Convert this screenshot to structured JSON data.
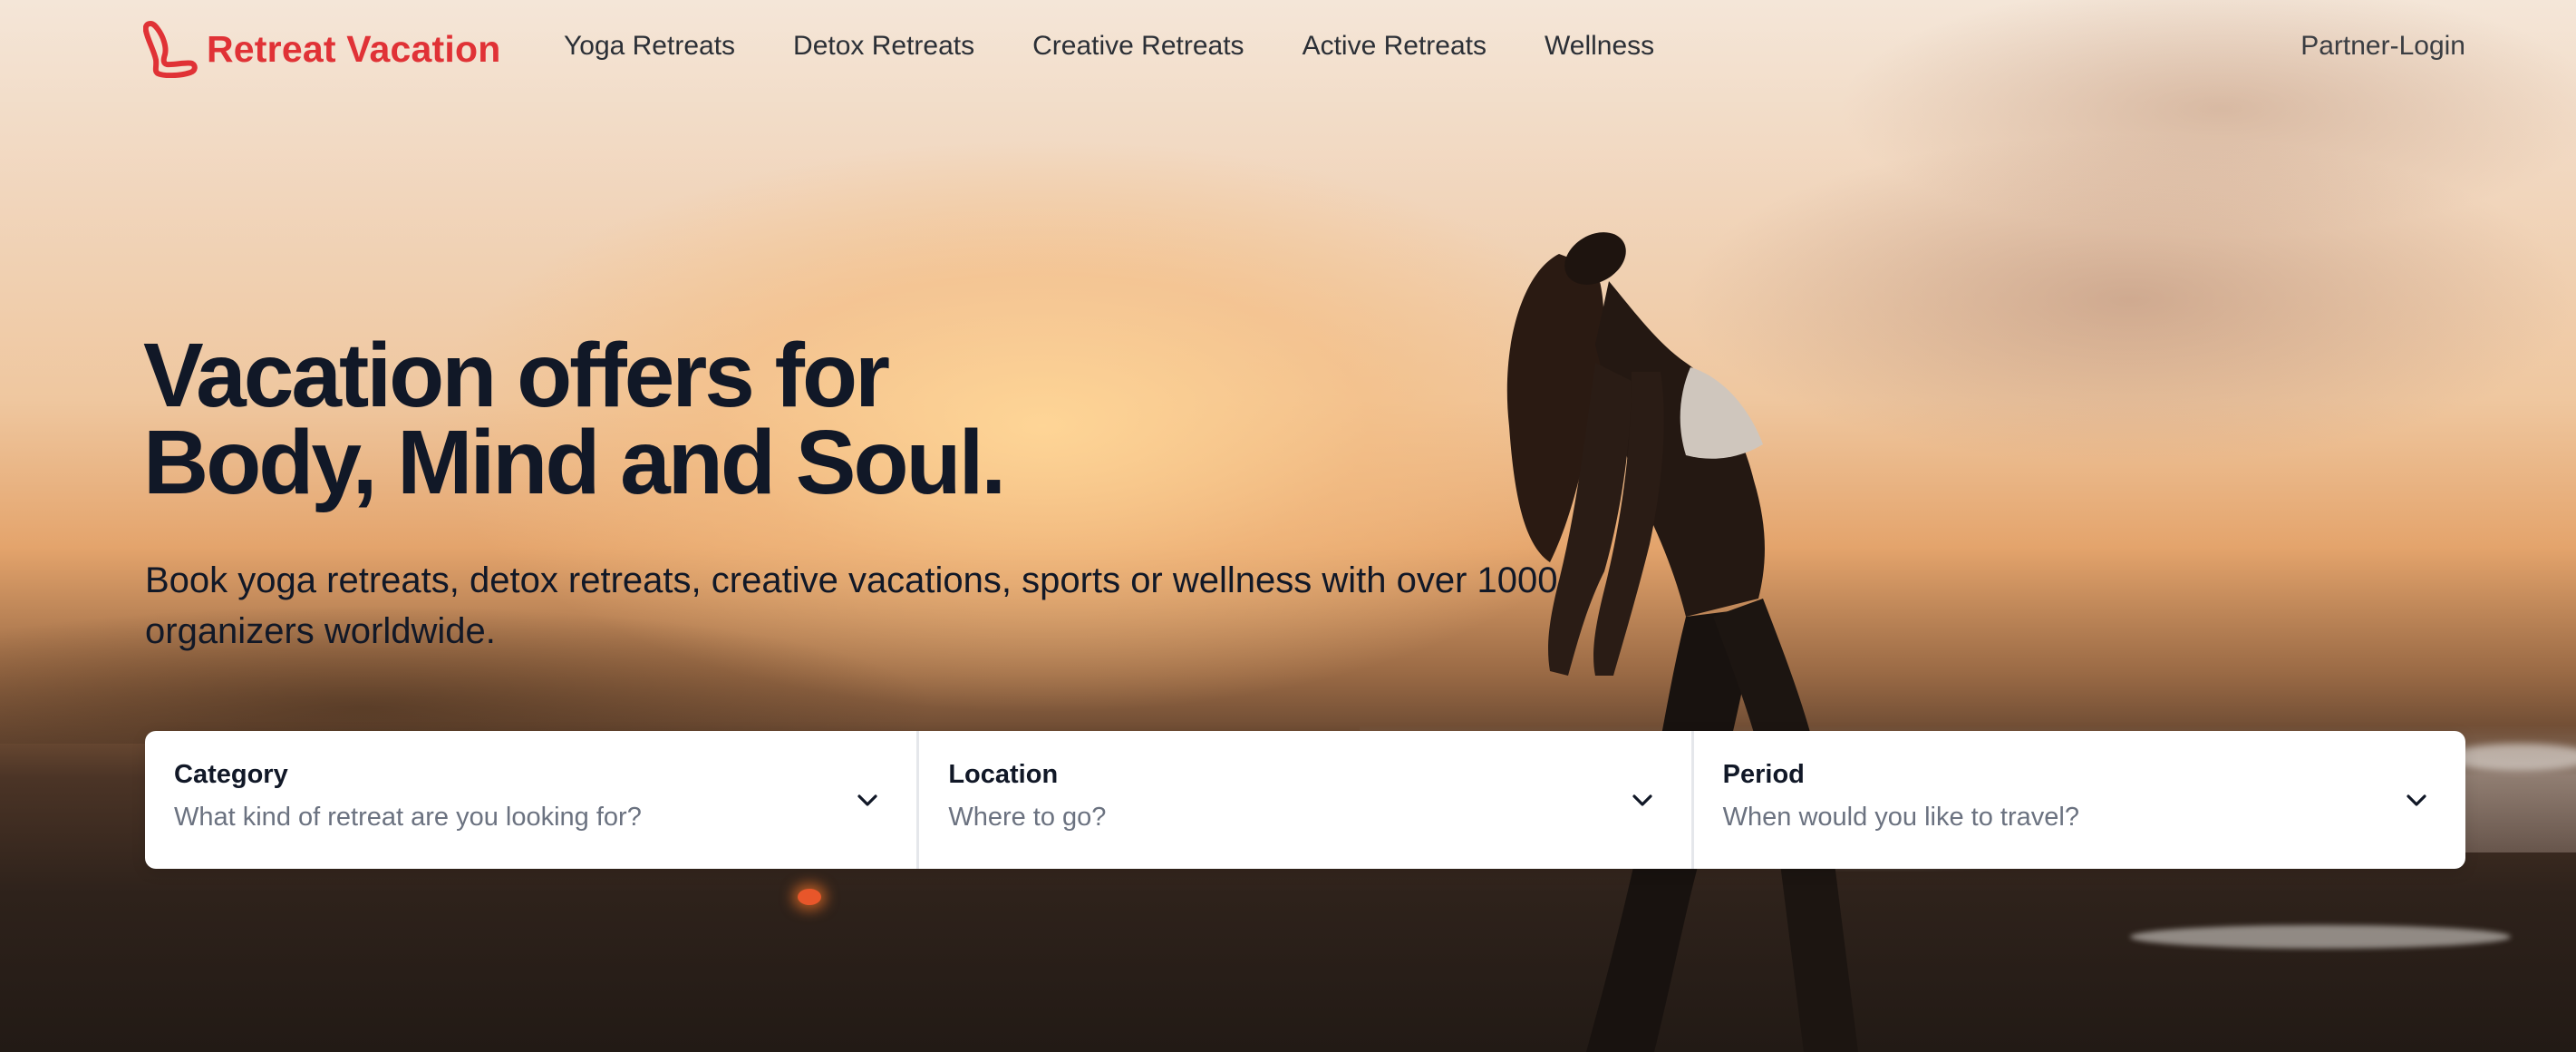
{
  "header": {
    "brand": "Retreat Vacation",
    "brand_color": "#e03236",
    "logo_icon": "retreat-logo-icon",
    "nav": [
      {
        "label": "Yoga Retreats"
      },
      {
        "label": "Detox Retreats"
      },
      {
        "label": "Creative Retreats"
      },
      {
        "label": "Active Retreats"
      },
      {
        "label": "Wellness"
      }
    ],
    "partner_login": "Partner-Login"
  },
  "hero": {
    "title_line1": "Vacation offers for",
    "title_line2": "Body, Mind and Soul.",
    "subtitle": "Book yoga retreats, detox retreats, creative vacations, sports or wellness with over 1000 organizers worldwide.",
    "background": "sunset-beach-yoga-photo"
  },
  "search": {
    "fields": [
      {
        "label": "Category",
        "placeholder": "What kind of retreat are you looking for?",
        "icon": "chevron-down-icon"
      },
      {
        "label": "Location",
        "placeholder": "Where to go?",
        "icon": "chevron-down-icon"
      },
      {
        "label": "Period",
        "placeholder": "When would you like to travel?",
        "icon": "chevron-down-icon"
      }
    ]
  }
}
